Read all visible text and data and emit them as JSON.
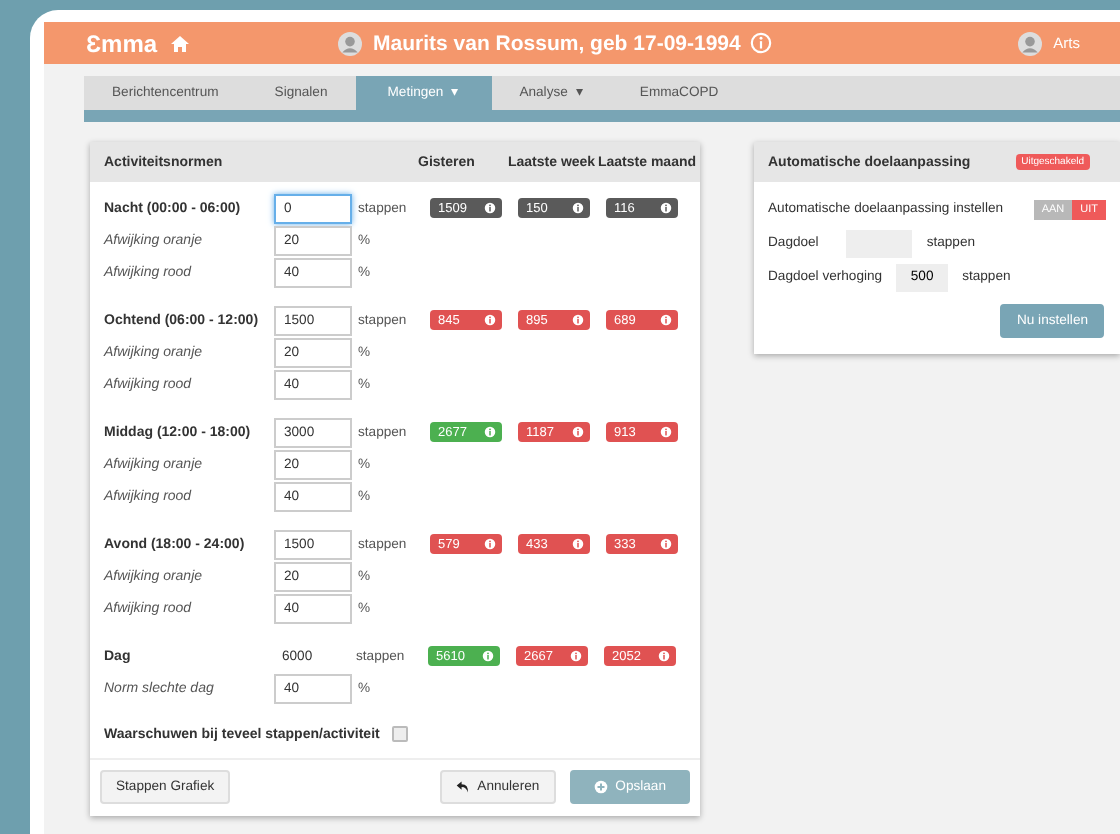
{
  "header": {
    "logo": "Ɛmma",
    "patient": "Maurits van Rossum, geb 17-09-1994",
    "user": "Arts"
  },
  "tabs": [
    {
      "label": "Berichtencentrum",
      "selected": false
    },
    {
      "label": "Signalen",
      "selected": false
    },
    {
      "label": "Metingen",
      "selected": true,
      "caret": "▾"
    },
    {
      "label": "Analyse",
      "selected": false,
      "caret": "▾"
    },
    {
      "label": "EmmaCOPD",
      "selected": false
    }
  ],
  "norms": {
    "title": "Activiteitsnormen",
    "columns": [
      "Gisteren",
      "Laatste week",
      "Laatste maand"
    ],
    "sections": [
      {
        "label": "Nacht (00:00 - 06:00)",
        "kind": "input",
        "value": "0",
        "unit": "stappen",
        "focused": true,
        "badges": [
          {
            "text": "1509",
            "color": "#5a5a5a"
          },
          {
            "text": "150",
            "color": "#5a5a5a"
          },
          {
            "text": "116",
            "color": "#5a5a5a"
          }
        ],
        "subs": [
          {
            "label": "Afwijking oranje",
            "value": "20",
            "unit": "%"
          },
          {
            "label": "Afwijking rood",
            "value": "40",
            "unit": "%"
          }
        ]
      },
      {
        "label": "Ochtend (06:00 - 12:00)",
        "kind": "input",
        "value": "1500",
        "unit": "stappen",
        "badges": [
          {
            "text": "845",
            "color": "#e05252"
          },
          {
            "text": "895",
            "color": "#e05252"
          },
          {
            "text": "689",
            "color": "#e05252"
          }
        ],
        "subs": [
          {
            "label": "Afwijking oranje",
            "value": "20",
            "unit": "%"
          },
          {
            "label": "Afwijking rood",
            "value": "40",
            "unit": "%"
          }
        ]
      },
      {
        "label": "Middag (12:00 - 18:00)",
        "kind": "input",
        "value": "3000",
        "unit": "stappen",
        "badges": [
          {
            "text": "2677",
            "color": "#4cb050"
          },
          {
            "text": "1187",
            "color": "#e05252"
          },
          {
            "text": "913",
            "color": "#e05252"
          }
        ],
        "subs": [
          {
            "label": "Afwijking oranje",
            "value": "20",
            "unit": "%"
          },
          {
            "label": "Afwijking rood",
            "value": "40",
            "unit": "%"
          }
        ]
      },
      {
        "label": "Avond (18:00 - 24:00)",
        "kind": "input",
        "value": "1500",
        "unit": "stappen",
        "badges": [
          {
            "text": "579",
            "color": "#e05252"
          },
          {
            "text": "433",
            "color": "#e05252"
          },
          {
            "text": "333",
            "color": "#e05252"
          }
        ],
        "subs": [
          {
            "label": "Afwijking oranje",
            "value": "20",
            "unit": "%"
          },
          {
            "label": "Afwijking rood",
            "value": "40",
            "unit": "%"
          }
        ]
      },
      {
        "label": "Dag",
        "kind": "plain",
        "value": "6000",
        "unit": "stappen",
        "badges": [
          {
            "text": "5610",
            "color": "#4cb050"
          },
          {
            "text": "2667",
            "color": "#e05252"
          },
          {
            "text": "2052",
            "color": "#e05252"
          }
        ],
        "subs": [
          {
            "label": "Norm slechte dag",
            "value": "40",
            "unit": "%"
          }
        ]
      }
    ],
    "warn": {
      "label": "Waarschuwen bij teveel stappen/activiteit",
      "checked": false
    },
    "buttons": {
      "chart": "Stappen Grafiek",
      "cancel": "Annuleren",
      "save": "Opslaan"
    }
  },
  "auto": {
    "title": "Automatische doelaanpassing",
    "status": "Uitgeschakeld",
    "setting": "Automatische doelaanpassing instellen",
    "toggle": [
      {
        "label": "AAN",
        "selected": false
      },
      {
        "label": "UIT",
        "selected": true
      }
    ],
    "goal": {
      "label": "Dagdoel",
      "unit": "stappen"
    },
    "increase": {
      "label": "Dagdoel verhoging",
      "value": "500",
      "unit": "stappen"
    },
    "apply": "Nu instellen"
  }
}
